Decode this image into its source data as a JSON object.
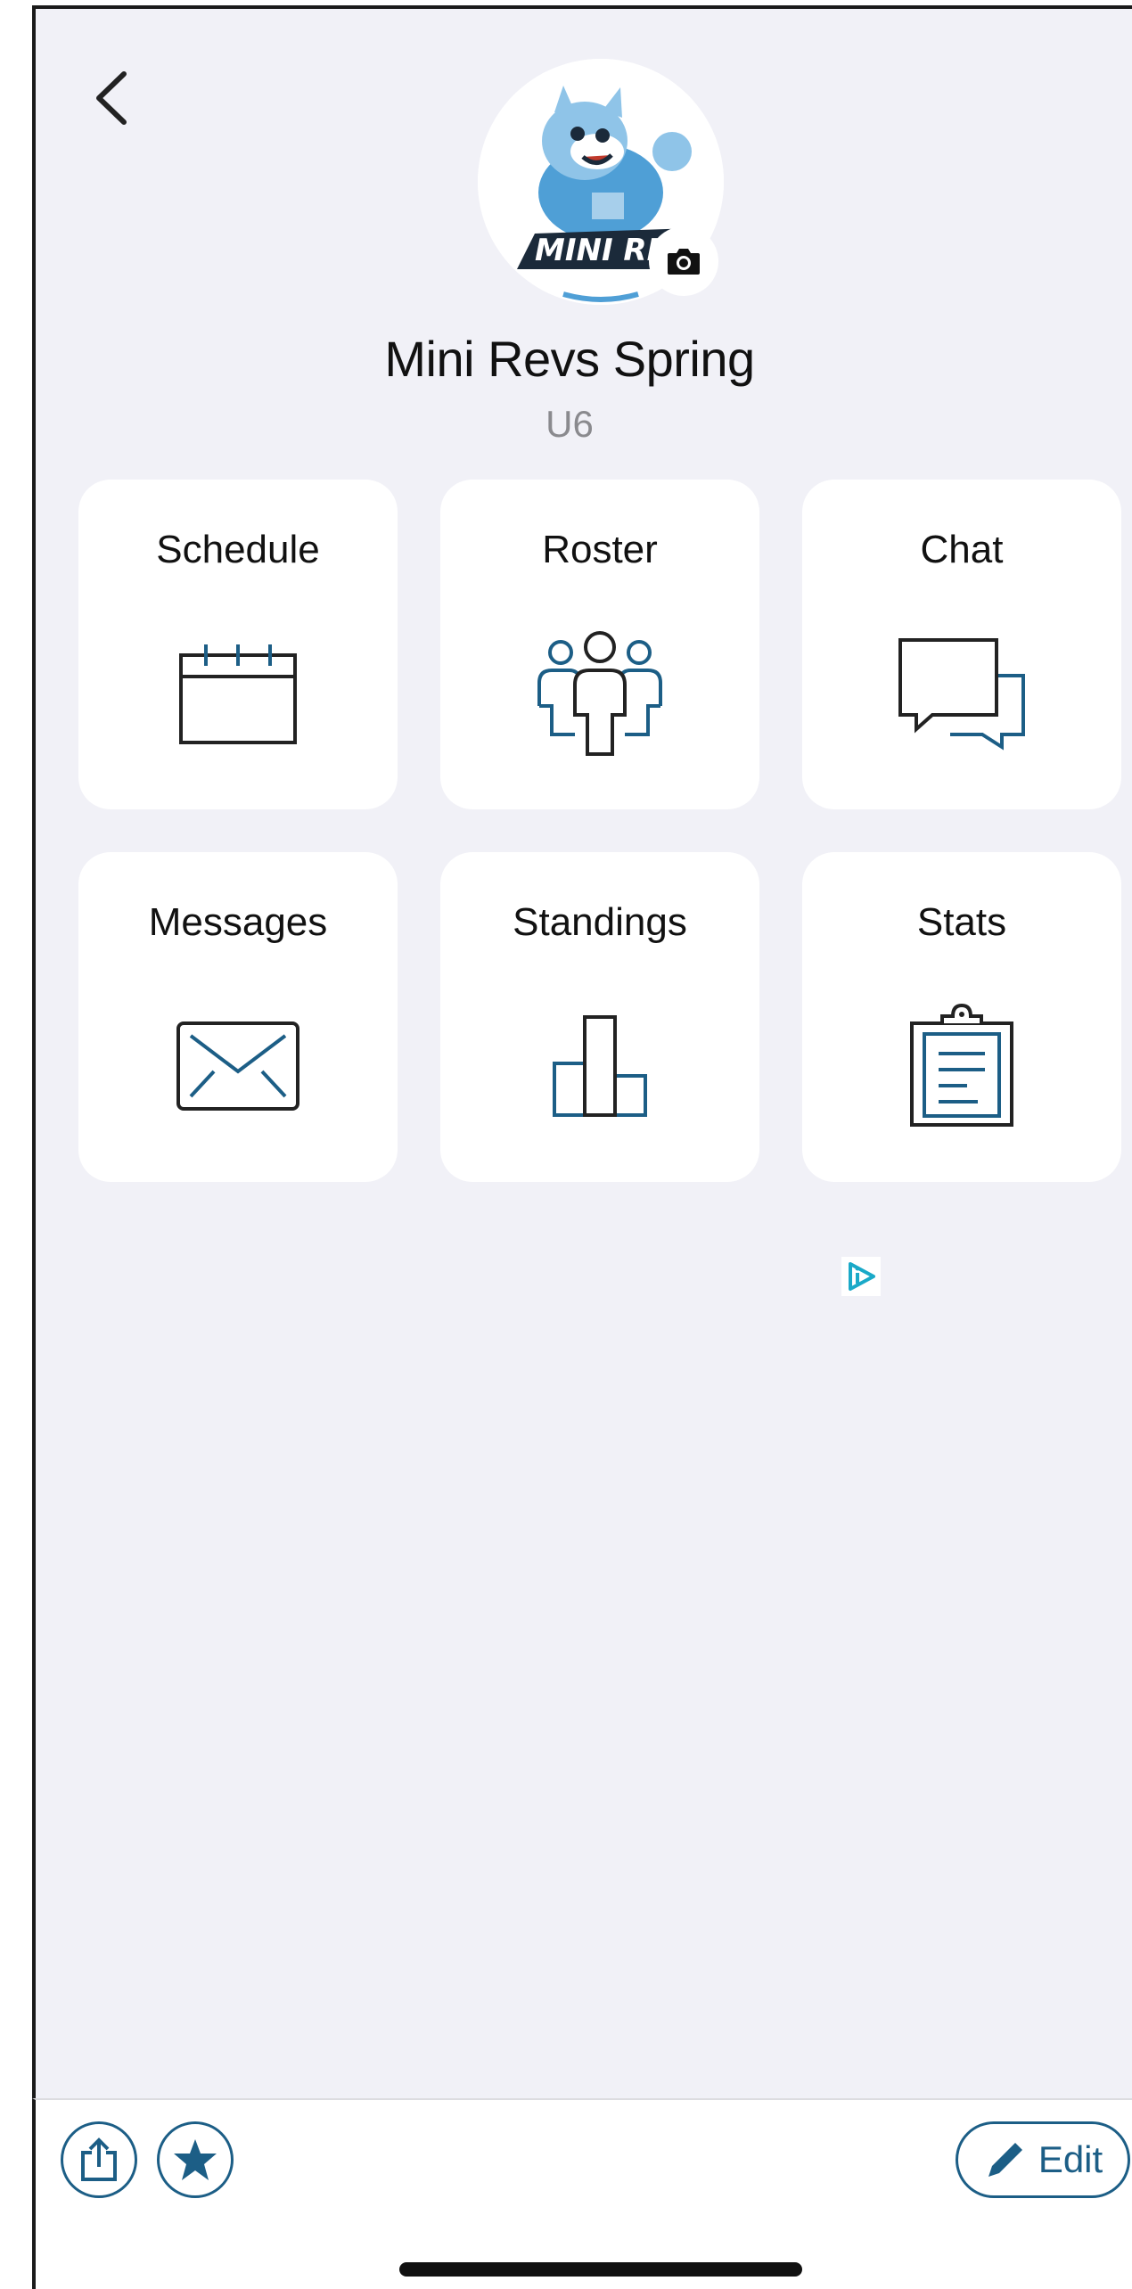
{
  "header": {
    "back_icon": "chevron-left-icon",
    "team_name": "Mini Revs Spring",
    "team_subtitle": "U6",
    "avatar_icon": "team-logo-image",
    "camera_icon": "camera-icon",
    "logo_text": "MINI REVS"
  },
  "tiles": [
    {
      "label": "Schedule",
      "icon": "calendar-icon"
    },
    {
      "label": "Roster",
      "icon": "people-icon"
    },
    {
      "label": "Chat",
      "icon": "chat-bubbles-icon"
    },
    {
      "label": "Messages",
      "icon": "envelope-icon"
    },
    {
      "label": "Standings",
      "icon": "bar-chart-icon"
    },
    {
      "label": "Stats",
      "icon": "clipboard-icon"
    }
  ],
  "ad": {
    "icon": "ad-choices-icon"
  },
  "bottom_bar": {
    "share_icon": "share-icon",
    "favorite_icon": "star-icon",
    "edit_label": "Edit",
    "edit_icon": "pencil-icon"
  },
  "colors": {
    "background": "#f1f1f7",
    "tile": "#ffffff",
    "accent": "#1c5e86",
    "icon_dark": "#222222"
  }
}
